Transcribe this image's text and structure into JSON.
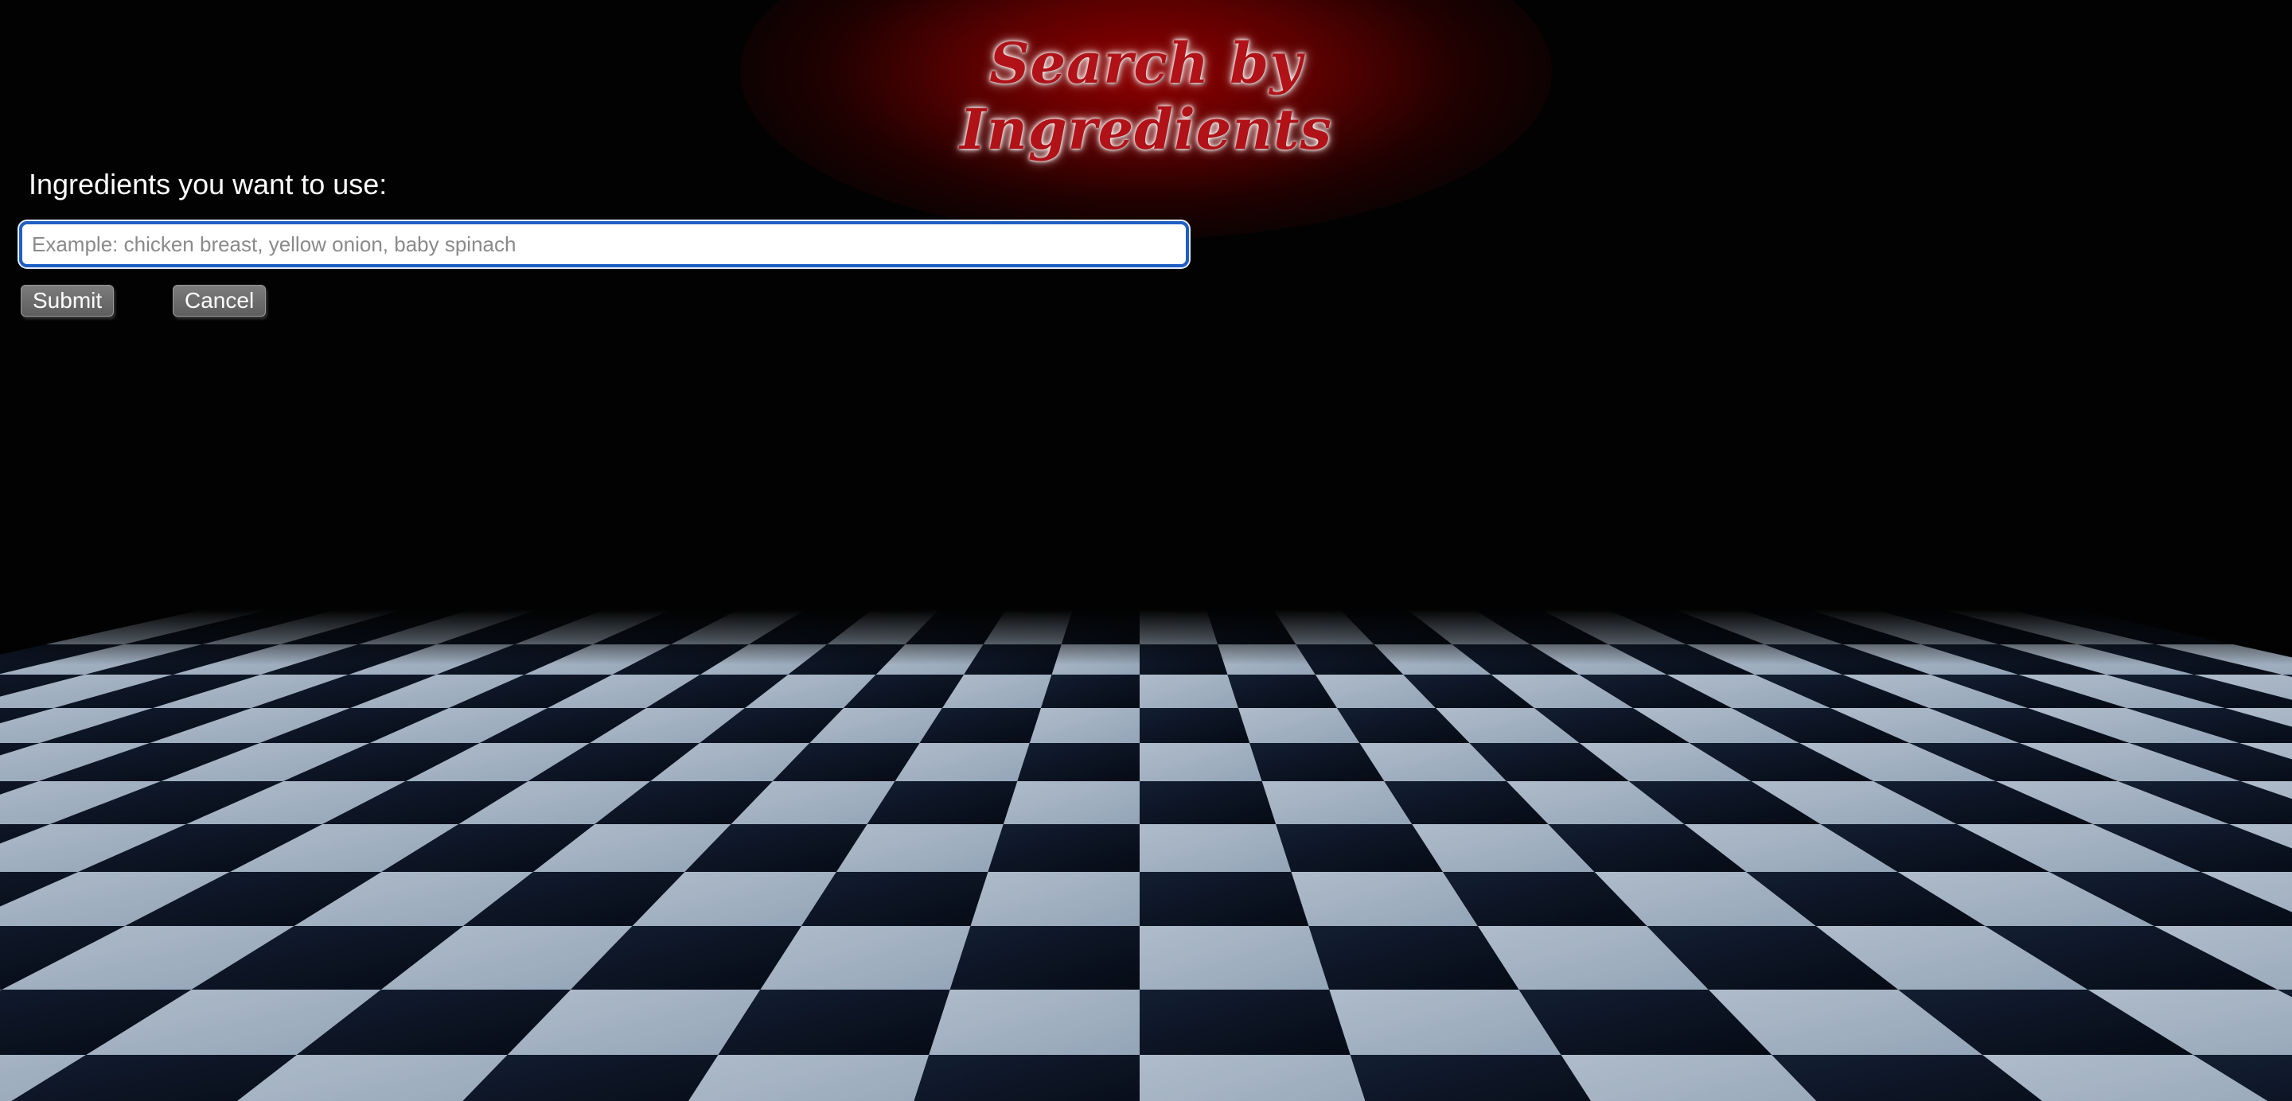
{
  "header": {
    "title": "Search by Ingredients",
    "title_color": "#b01218"
  },
  "form": {
    "label": "Ingredients you want to use:",
    "input": {
      "value": "",
      "placeholder": "Example: chicken breast, yellow onion, baby spinach"
    },
    "submit_label": "Submit",
    "cancel_label": "Cancel"
  },
  "background": {
    "floor_pattern": "checkered-floor",
    "light_tile_color": "#b9c9dc",
    "dark_tile_color": "#0d1624"
  }
}
